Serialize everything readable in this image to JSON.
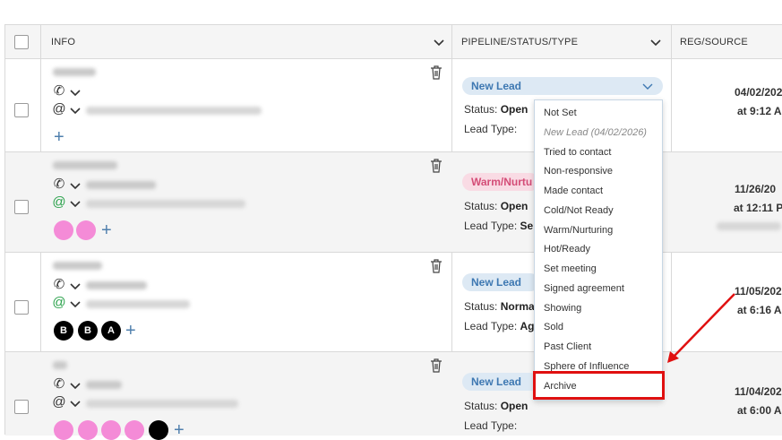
{
  "header": {
    "info": "INFO",
    "pipeline": "PIPELINE/STATUS/TYPE",
    "reg": "REG/SOURCE"
  },
  "rows": [
    {
      "pipeline_label": "New Lead",
      "status_label": "Status:",
      "status_value": "Open",
      "type_label": "Lead Type:",
      "type_value": "",
      "reg_date": "04/02/202",
      "reg_time": "at 9:12 A"
    },
    {
      "pipeline_label": "Warm/Nurtu",
      "status_label": "Status:",
      "status_value": "Open",
      "type_label": "Lead Type:",
      "type_value": "Selle",
      "reg_date": "11/26/20",
      "reg_time": "at 12:11 P",
      "avatars": []
    },
    {
      "pipeline_label": "New Lead",
      "status_label": "Status:",
      "status_value": "Normal",
      "type_label": "Lead Type:",
      "type_value": "Age",
      "reg_date": "11/05/202",
      "reg_time": "at 6:16 A",
      "avatars": [
        "B",
        "B",
        "A"
      ]
    },
    {
      "pipeline_label": "New Lead",
      "status_label": "Status:",
      "status_value": "Open",
      "type_label": "Lead Type:",
      "type_value": "",
      "reg_date": "11/04/202",
      "reg_time": "at 6:00 A"
    }
  ],
  "dropdown": {
    "options": [
      "Not Set",
      "New Lead (04/02/2026)",
      "Tried to contact",
      "Non-responsive",
      "Made contact",
      "Cold/Not Ready",
      "Warm/Nurturing",
      "Hot/Ready",
      "Set meeting",
      "Signed agreement",
      "Showing",
      "Sold",
      "Past Client",
      "Sphere of Influence",
      "Archive"
    ],
    "highlighted": "Archive"
  },
  "colors": {
    "accent": "#3e78b2",
    "warm": "#d44d77",
    "highlight": "#e01010",
    "avatar_pink": "#f48bd7"
  },
  "icons": {
    "phone": "phone-icon",
    "email": "at-icon",
    "delete": "trash-icon",
    "add": "plus-icon",
    "expand": "chevron-down-icon"
  }
}
